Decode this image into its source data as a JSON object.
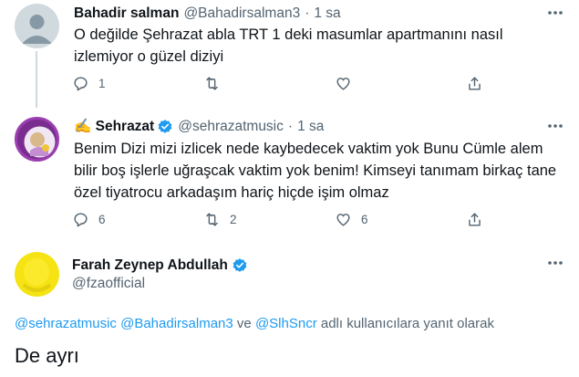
{
  "tweet1": {
    "name": "Bahadir salman",
    "handle": "@Bahadirsalman3",
    "dot": "·",
    "time": "1 sa",
    "text": "O değilde Şehrazat abla TRT 1 deki masumlar apartmanını nasıl izlemiyor o güzel diziyi",
    "reply_count": "1",
    "retweet_count": "",
    "like_count": ""
  },
  "tweet2": {
    "name": "✍️ Sehrazat",
    "handle": "@sehrazatmusic",
    "dot": "·",
    "time": "1 sa",
    "verified": true,
    "text": "Benim Dizi mizi izlicek nede kaybedecek vaktim yok Bunu Cümle alem bilir boş işlerle uğraşcak vaktim yok benim! Kimseyi tanımam birkaç tane özel tiyatrocu arkadaşım hariç hiçde işim olmaz",
    "reply_count": "6",
    "retweet_count": "2",
    "like_count": "6"
  },
  "main_tweet": {
    "name": "Farah Zeynep Abdullah",
    "handle": "@fzaofficial",
    "verified": true,
    "reply_prefix_mention1": "@sehrazatmusic",
    "reply_prefix_mention2": "@Bahadirsalman3",
    "reply_prefix_and": " ve ",
    "reply_prefix_mention3": "@SlhSncr",
    "reply_prefix_suffix": " adlı kullanıcılara yanıt olarak",
    "text": "De ayrı"
  },
  "colors": {
    "accent": "#1d9bf0",
    "secondary_text": "#536471",
    "thread_line": "#cfd9de",
    "avatar_yellow": "#f5e313"
  },
  "icons": [
    "default-avatar-icon",
    "more-icon",
    "reply-icon",
    "retweet-icon",
    "like-icon",
    "share-icon",
    "verified-badge-icon"
  ]
}
